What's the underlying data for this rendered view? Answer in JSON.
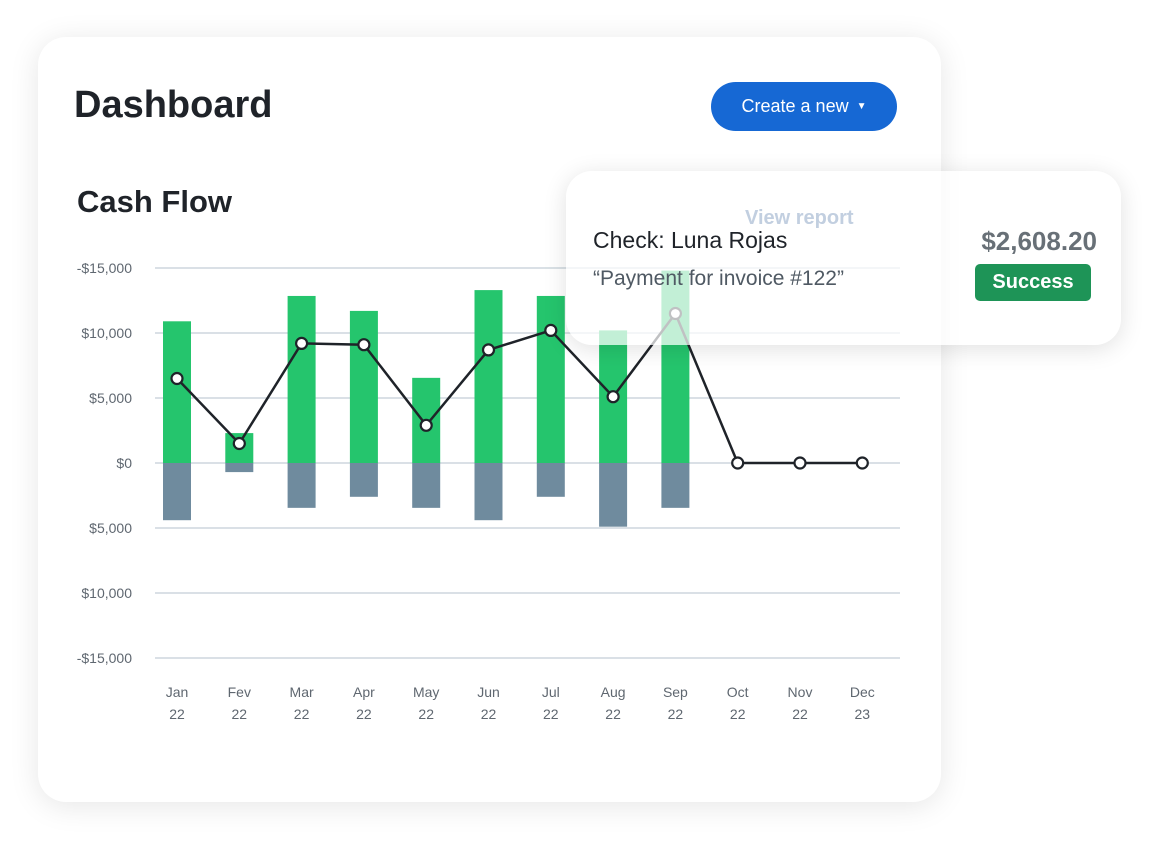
{
  "header": {
    "title": "Dashboard",
    "create_button": "Create a new",
    "caret_icon": "caret-down"
  },
  "section": {
    "title": "Cash Flow",
    "view_report": "View report"
  },
  "popup": {
    "name": "Check: Luna Rojas",
    "memo": "“Payment for invoice #122”",
    "amount": "$2,608.20",
    "status": "Success"
  },
  "colors": {
    "inflow": "#25c56d",
    "outflow": "#6f8b9e",
    "line": "#1f2329",
    "accent": "#1668d4",
    "success": "#1e9457"
  },
  "chart_data": {
    "type": "bar",
    "title": "Cash Flow",
    "categories": [
      "Jan 22",
      "Fev 22",
      "Mar 22",
      "Apr 22",
      "May 22",
      "Jun 22",
      "Jul 22",
      "Aug 22",
      "Sep 22",
      "Oct 22",
      "Nov 22",
      "Dec 23"
    ],
    "y_ticks": [
      "-$15,000",
      "$10,000",
      "$5,000",
      "$0",
      "$5,000",
      "$10,000",
      "-$15,000"
    ],
    "y_tick_values": [
      15000,
      10000,
      5000,
      0,
      -5000,
      -10000,
      -15000
    ],
    "ylim": [
      -15000,
      15000
    ],
    "grid": true,
    "series": [
      {
        "type": "bar",
        "values": [
          10900,
          2300,
          12850,
          11700,
          6550,
          13300,
          12850,
          10200,
          14800,
          0,
          0,
          0
        ]
      },
      {
        "type": "bar",
        "values": [
          -4400,
          -700,
          -3450,
          -2600,
          -3450,
          -4400,
          -2600,
          -4900,
          -3450,
          0,
          0,
          0
        ]
      },
      {
        "type": "line",
        "values": [
          6500,
          1500,
          9200,
          9100,
          2900,
          8700,
          10200,
          5100,
          11500,
          0,
          0,
          0
        ]
      }
    ]
  }
}
